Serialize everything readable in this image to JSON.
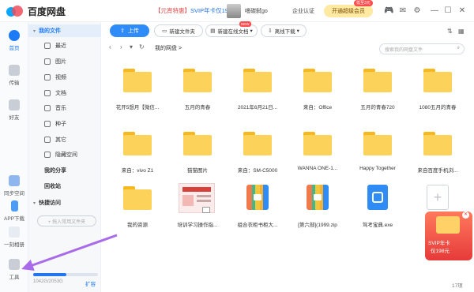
{
  "app": {
    "title": "百度网盘",
    "promo_prefix": "【元宵特惠】",
    "promo_text": "SVIP年卡仅198元",
    "username": "嗜碳弑go",
    "verify": "企业认证",
    "vip_button": "开通超级会员",
    "vip_badge": "低至3元",
    "accent": "#1e7bf5"
  },
  "rail": [
    {
      "label": "首页",
      "icon": "home-icon",
      "active": true
    },
    {
      "label": "传输",
      "icon": "transfer-icon"
    },
    {
      "label": "好友",
      "icon": "friends-icon"
    },
    {
      "label": "同步空间",
      "icon": "sync-icon"
    },
    {
      "label": "APP下载",
      "icon": "phone-icon"
    },
    {
      "label": "一刻相册",
      "icon": "album-icon"
    },
    {
      "label": "工具",
      "icon": "tools-icon"
    }
  ],
  "sidebar": {
    "my_files": "我的文件",
    "categories": [
      "最近",
      "图片",
      "视频",
      "文档",
      "音乐",
      "种子",
      "其它",
      "隐藏空间"
    ],
    "my_share": "我的分享",
    "recycle": "回收站",
    "quick_access": "快捷访问",
    "add_quick": "+ 拖入常用文件夹",
    "storage": "1042G/2053G",
    "storage_fraction": 0.51,
    "expand": "扩容"
  },
  "toolbar": {
    "upload": "上传",
    "new_folder": "新建文件夹",
    "new_online_doc": "新建在线文档",
    "new_tag": "NEW",
    "offline_download": "离线下载"
  },
  "nav": {
    "breadcrumb": "我的网盘  >",
    "search_placeholder": "搜索我的网盘文件"
  },
  "files": [
    {
      "name": "花开5想月【微信...",
      "kind": "folder"
    },
    {
      "name": "五月的青春",
      "kind": "folder"
    },
    {
      "name": "2021年6月21日...",
      "kind": "folder"
    },
    {
      "name": "来自：Office",
      "kind": "folder"
    },
    {
      "name": "五月的青春720",
      "kind": "folder"
    },
    {
      "name": "1080五月的青春",
      "kind": "folder"
    },
    {
      "name": "来自：vivo Z1",
      "kind": "folder"
    },
    {
      "name": "猫猫图片",
      "kind": "folder"
    },
    {
      "name": "来自：SM-C5000",
      "kind": "folder"
    },
    {
      "name": "WANNA ONE-1...",
      "kind": "folder"
    },
    {
      "name": "Happy Together",
      "kind": "folder"
    },
    {
      "name": "来自百度手机浏...",
      "kind": "folder"
    },
    {
      "name": "我的资源",
      "kind": "folder"
    },
    {
      "name": "培训学习操作指...",
      "kind": "image"
    },
    {
      "name": "组合衣柜书柜大...",
      "kind": "zip"
    },
    {
      "name": "[第六部](1999.zip",
      "kind": "zip"
    },
    {
      "name": "驾考宝典.exe",
      "kind": "exe"
    },
    {
      "name": "上传文件",
      "kind": "add"
    }
  ],
  "promo_card": {
    "line1": "SVIP年卡",
    "line2": "仅198元"
  },
  "item_count": "17项"
}
